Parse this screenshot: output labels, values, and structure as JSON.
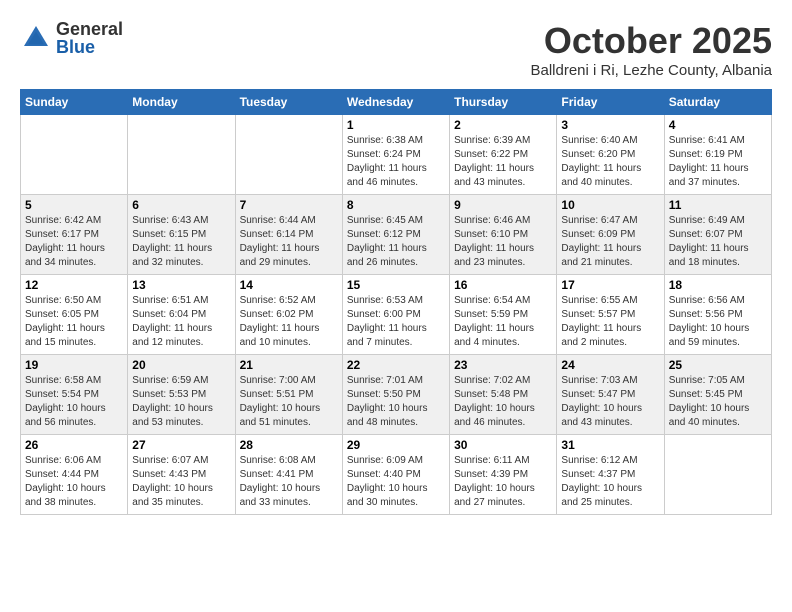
{
  "logo": {
    "general": "General",
    "blue": "Blue"
  },
  "header": {
    "month": "October 2025",
    "location": "Balldreni i Ri, Lezhe County, Albania"
  },
  "weekdays": [
    "Sunday",
    "Monday",
    "Tuesday",
    "Wednesday",
    "Thursday",
    "Friday",
    "Saturday"
  ],
  "weeks": [
    [
      {
        "day": "",
        "info": ""
      },
      {
        "day": "",
        "info": ""
      },
      {
        "day": "",
        "info": ""
      },
      {
        "day": "1",
        "info": "Sunrise: 6:38 AM\nSunset: 6:24 PM\nDaylight: 11 hours and 46 minutes."
      },
      {
        "day": "2",
        "info": "Sunrise: 6:39 AM\nSunset: 6:22 PM\nDaylight: 11 hours and 43 minutes."
      },
      {
        "day": "3",
        "info": "Sunrise: 6:40 AM\nSunset: 6:20 PM\nDaylight: 11 hours and 40 minutes."
      },
      {
        "day": "4",
        "info": "Sunrise: 6:41 AM\nSunset: 6:19 PM\nDaylight: 11 hours and 37 minutes."
      }
    ],
    [
      {
        "day": "5",
        "info": "Sunrise: 6:42 AM\nSunset: 6:17 PM\nDaylight: 11 hours and 34 minutes."
      },
      {
        "day": "6",
        "info": "Sunrise: 6:43 AM\nSunset: 6:15 PM\nDaylight: 11 hours and 32 minutes."
      },
      {
        "day": "7",
        "info": "Sunrise: 6:44 AM\nSunset: 6:14 PM\nDaylight: 11 hours and 29 minutes."
      },
      {
        "day": "8",
        "info": "Sunrise: 6:45 AM\nSunset: 6:12 PM\nDaylight: 11 hours and 26 minutes."
      },
      {
        "day": "9",
        "info": "Sunrise: 6:46 AM\nSunset: 6:10 PM\nDaylight: 11 hours and 23 minutes."
      },
      {
        "day": "10",
        "info": "Sunrise: 6:47 AM\nSunset: 6:09 PM\nDaylight: 11 hours and 21 minutes."
      },
      {
        "day": "11",
        "info": "Sunrise: 6:49 AM\nSunset: 6:07 PM\nDaylight: 11 hours and 18 minutes."
      }
    ],
    [
      {
        "day": "12",
        "info": "Sunrise: 6:50 AM\nSunset: 6:05 PM\nDaylight: 11 hours and 15 minutes."
      },
      {
        "day": "13",
        "info": "Sunrise: 6:51 AM\nSunset: 6:04 PM\nDaylight: 11 hours and 12 minutes."
      },
      {
        "day": "14",
        "info": "Sunrise: 6:52 AM\nSunset: 6:02 PM\nDaylight: 11 hours and 10 minutes."
      },
      {
        "day": "15",
        "info": "Sunrise: 6:53 AM\nSunset: 6:00 PM\nDaylight: 11 hours and 7 minutes."
      },
      {
        "day": "16",
        "info": "Sunrise: 6:54 AM\nSunset: 5:59 PM\nDaylight: 11 hours and 4 minutes."
      },
      {
        "day": "17",
        "info": "Sunrise: 6:55 AM\nSunset: 5:57 PM\nDaylight: 11 hours and 2 minutes."
      },
      {
        "day": "18",
        "info": "Sunrise: 6:56 AM\nSunset: 5:56 PM\nDaylight: 10 hours and 59 minutes."
      }
    ],
    [
      {
        "day": "19",
        "info": "Sunrise: 6:58 AM\nSunset: 5:54 PM\nDaylight: 10 hours and 56 minutes."
      },
      {
        "day": "20",
        "info": "Sunrise: 6:59 AM\nSunset: 5:53 PM\nDaylight: 10 hours and 53 minutes."
      },
      {
        "day": "21",
        "info": "Sunrise: 7:00 AM\nSunset: 5:51 PM\nDaylight: 10 hours and 51 minutes."
      },
      {
        "day": "22",
        "info": "Sunrise: 7:01 AM\nSunset: 5:50 PM\nDaylight: 10 hours and 48 minutes."
      },
      {
        "day": "23",
        "info": "Sunrise: 7:02 AM\nSunset: 5:48 PM\nDaylight: 10 hours and 46 minutes."
      },
      {
        "day": "24",
        "info": "Sunrise: 7:03 AM\nSunset: 5:47 PM\nDaylight: 10 hours and 43 minutes."
      },
      {
        "day": "25",
        "info": "Sunrise: 7:05 AM\nSunset: 5:45 PM\nDaylight: 10 hours and 40 minutes."
      }
    ],
    [
      {
        "day": "26",
        "info": "Sunrise: 6:06 AM\nSunset: 4:44 PM\nDaylight: 10 hours and 38 minutes."
      },
      {
        "day": "27",
        "info": "Sunrise: 6:07 AM\nSunset: 4:43 PM\nDaylight: 10 hours and 35 minutes."
      },
      {
        "day": "28",
        "info": "Sunrise: 6:08 AM\nSunset: 4:41 PM\nDaylight: 10 hours and 33 minutes."
      },
      {
        "day": "29",
        "info": "Sunrise: 6:09 AM\nSunset: 4:40 PM\nDaylight: 10 hours and 30 minutes."
      },
      {
        "day": "30",
        "info": "Sunrise: 6:11 AM\nSunset: 4:39 PM\nDaylight: 10 hours and 27 minutes."
      },
      {
        "day": "31",
        "info": "Sunrise: 6:12 AM\nSunset: 4:37 PM\nDaylight: 10 hours and 25 minutes."
      },
      {
        "day": "",
        "info": ""
      }
    ]
  ]
}
